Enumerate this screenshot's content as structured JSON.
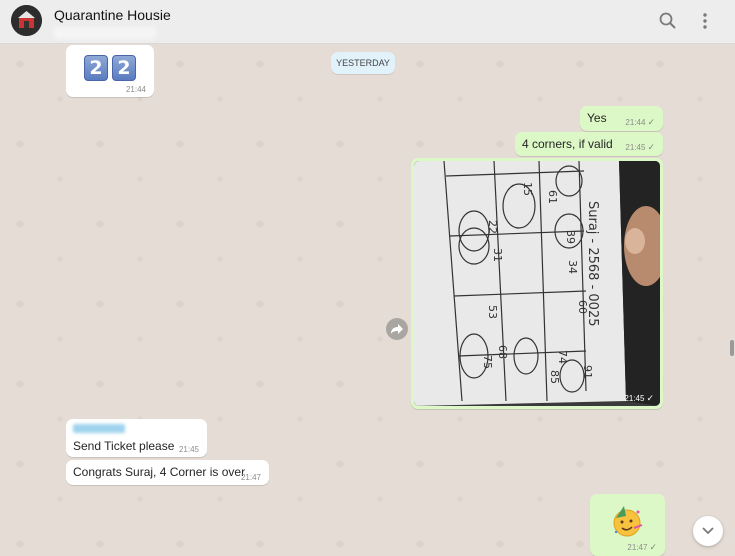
{
  "header": {
    "title": "Quarantine Housie",
    "search_icon": "search-icon",
    "menu_icon": "menu-icon"
  },
  "date_divider": "YESTERDAY",
  "messages": [
    {
      "id": "m1",
      "type": "emoji",
      "direction": "in",
      "content": "2 2",
      "digits": [
        "2",
        "2"
      ],
      "time": "21:44"
    },
    {
      "id": "m2",
      "type": "text",
      "direction": "out",
      "text": "Yes",
      "time": "21:44",
      "status": "sent"
    },
    {
      "id": "m3",
      "type": "text",
      "direction": "out",
      "text": "4 corners, if valid",
      "time": "21:45",
      "status": "sent"
    },
    {
      "id": "m4",
      "type": "image",
      "direction": "out",
      "description": "photo of handwritten housie ticket",
      "time": "21:45",
      "status": "sent",
      "ticket_text": [
        "15",
        "22",
        "31",
        "39",
        "34",
        "61",
        "53",
        "68",
        "75",
        "74",
        "85",
        "91",
        "60"
      ]
    },
    {
      "id": "m5",
      "type": "text",
      "direction": "in",
      "text": "Send Ticket please",
      "time": "21:45"
    },
    {
      "id": "m6",
      "type": "text",
      "direction": "in",
      "text": "Congrats Suraj, 4 Corner is over",
      "time": "21:47"
    },
    {
      "id": "m7",
      "type": "emoji",
      "direction": "out",
      "content": "partying-face",
      "time": "21:47",
      "status": "sent"
    }
  ],
  "colors": {
    "outgoing": "#dcf8c6",
    "incoming": "#ffffff",
    "background": "#e5ddd5",
    "date_pill": "#e1f2fb"
  }
}
